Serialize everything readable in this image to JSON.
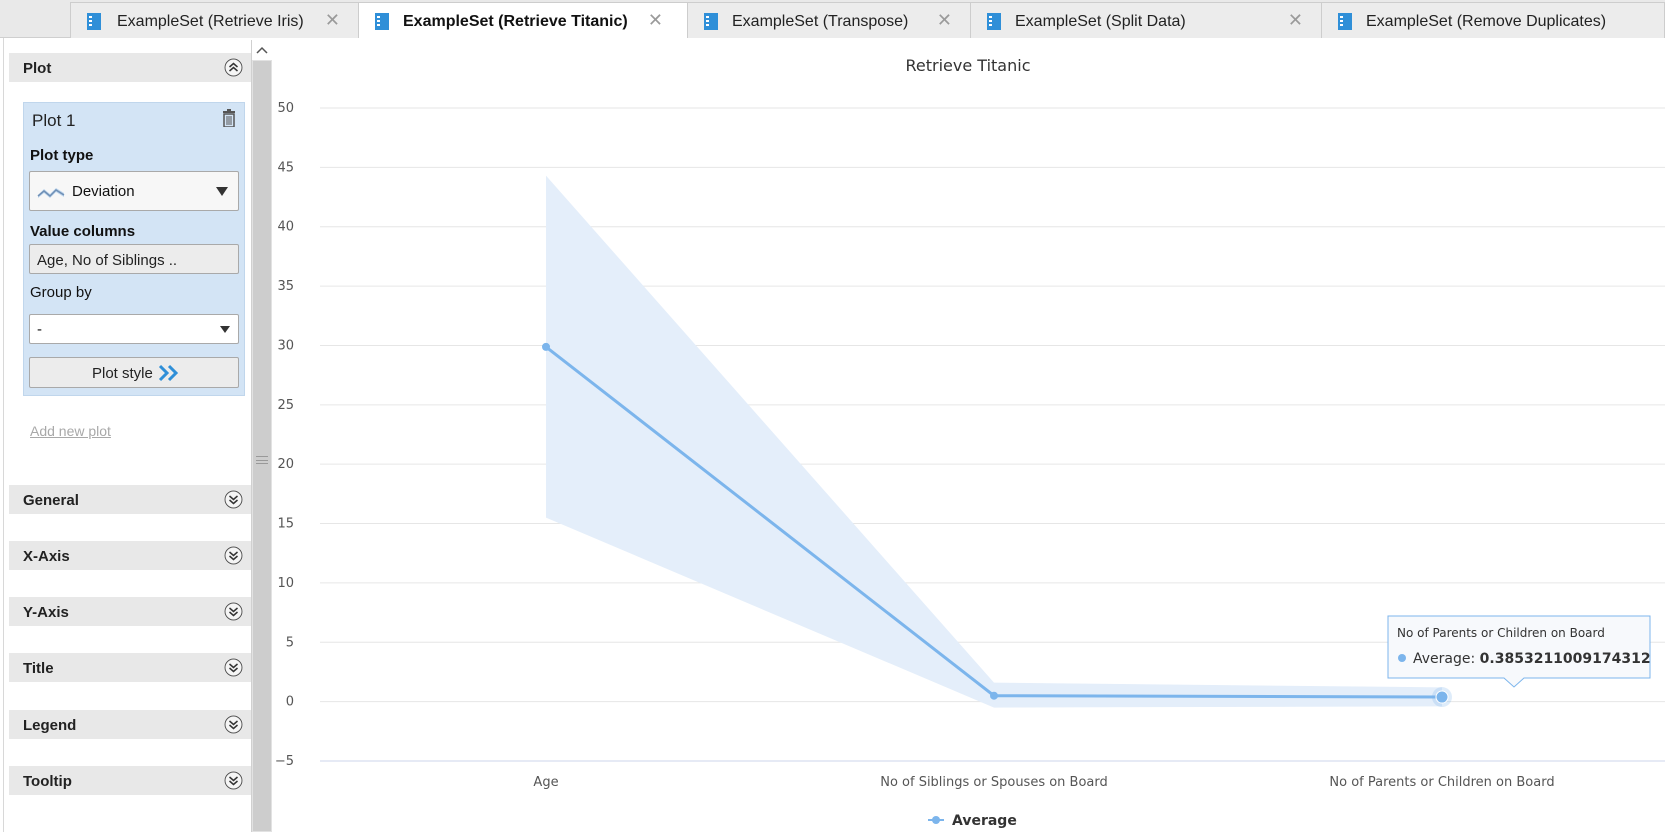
{
  "tabs": [
    {
      "label": "ExampleSet (Retrieve Iris)",
      "active": false
    },
    {
      "label": "ExampleSet (Retrieve Titanic)",
      "active": true
    },
    {
      "label": "ExampleSet (Transpose)",
      "active": false
    },
    {
      "label": "ExampleSet (Split Data)",
      "active": false
    },
    {
      "label": "ExampleSet (Remove Duplicates)",
      "active": false
    }
  ],
  "sidebar": {
    "plot_section": "Plot",
    "plot_box": {
      "title": "Plot 1",
      "plot_type_label": "Plot type",
      "plot_type_value": "Deviation",
      "value_columns_label": "Value columns",
      "value_columns_value": "Age, No of Siblings ..",
      "group_by_label": "Group by",
      "group_by_value": "-",
      "plot_style_label": "Plot style"
    },
    "add_new_plot": "Add new plot",
    "sections": [
      "General",
      "X-Axis",
      "Y-Axis",
      "Title",
      "Legend",
      "Tooltip"
    ]
  },
  "colors": {
    "accent": "#7cb5ec",
    "band": "#e4eefa",
    "panel_selected": "#d3e4f5",
    "icon_blue": "#2f8fd8"
  },
  "chart_data": {
    "type": "line",
    "title": "Retrieve Titanic",
    "categories": [
      "Age",
      "No of Siblings or Spouses on Board",
      "No of Parents or Children on Board"
    ],
    "series": [
      {
        "name": "Average",
        "values": [
          29.88,
          0.5,
          0.3853211009174312
        ],
        "low": [
          15.5,
          -0.5,
          -0.4
        ],
        "high": [
          44.3,
          1.6,
          1.2
        ]
      }
    ],
    "ylim": [
      -5,
      50
    ],
    "yticks": [
      -5,
      0,
      5,
      10,
      15,
      20,
      25,
      30,
      35,
      40,
      45,
      50
    ],
    "grid": true,
    "legend": "bottom-center",
    "tooltip": {
      "title": "No of Parents or Children on Board",
      "label": "Average: ",
      "value": "0.3853211009174312"
    }
  }
}
